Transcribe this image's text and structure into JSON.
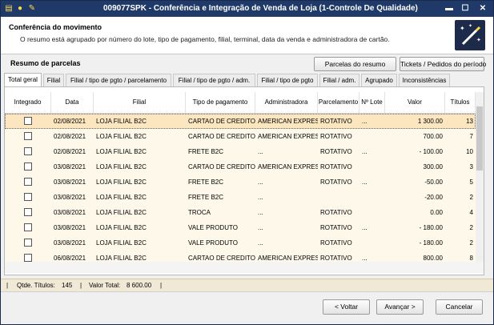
{
  "window": {
    "title": "009077SPK - Conferência e Integração de Venda de Loja (1-Controle De Qualidade)",
    "buttons": {
      "minimize": "▬",
      "maximize": "☐",
      "close": "✕"
    }
  },
  "header": {
    "title": "Conferência do movimento",
    "subtitle": "O resumo está agrupado por número do lote, tipo de pagamento, filial, terminal, data da venda e administradora de cartão."
  },
  "summary": {
    "title": "Resumo de parcelas",
    "btn_parcelas": "Parcelas do resumo",
    "btn_tickets": "Tickets / Pedidos do período"
  },
  "tabs": [
    {
      "label": "Total geral"
    },
    {
      "label": "Filial"
    },
    {
      "label": "Filial / tipo de pgto / parcelamento"
    },
    {
      "label": "Filial / tipo de pgto / adm."
    },
    {
      "label": "Filial / tipo de pgto"
    },
    {
      "label": "Filial / adm."
    },
    {
      "label": "Agrupado"
    },
    {
      "label": "Inconsistências"
    }
  ],
  "grid": {
    "columns": [
      "Integrado",
      "Data",
      "Filial",
      "Tipo de pagamento",
      "Administradora",
      "Parcelamento",
      "Nº Lote",
      "Valor",
      "Títulos"
    ],
    "rows": [
      {
        "data": "02/08/2021",
        "filial": "LOJA FILIAL B2C",
        "tipo": "CARTAO DE CREDITO F",
        "adm": "AMERICAN EXPRESS",
        "parc": "ROTATIVO",
        "lote": "...",
        "valor": "1 300.00",
        "titulos": "13"
      },
      {
        "data": "02/08/2021",
        "filial": "LOJA FILIAL B2C",
        "tipo": "CARTAO DE CREDITO F",
        "adm": "AMERICAN EXPRESS",
        "parc": "ROTATIVO",
        "lote": "",
        "valor": "700.00",
        "titulos": "7"
      },
      {
        "data": "02/08/2021",
        "filial": "LOJA FILIAL B2C",
        "tipo": "FRETE B2C",
        "adm": "...",
        "parc": "ROTATIVO",
        "lote": "...",
        "valor": "- 100.00",
        "titulos": "10"
      },
      {
        "data": "03/08/2021",
        "filial": "LOJA FILIAL B2C",
        "tipo": "CARTAO DE CREDITO F",
        "adm": "AMERICAN EXPRESS",
        "parc": "ROTATIVO",
        "lote": "",
        "valor": "300.00",
        "titulos": "3"
      },
      {
        "data": "03/08/2021",
        "filial": "LOJA FILIAL B2C",
        "tipo": "FRETE B2C",
        "adm": "...",
        "parc": "ROTATIVO",
        "lote": "...",
        "valor": "-50.00",
        "titulos": "5"
      },
      {
        "data": "03/08/2021",
        "filial": "LOJA FILIAL B2C",
        "tipo": "FRETE B2C",
        "adm": "...",
        "parc": "",
        "lote": "",
        "valor": "-20.00",
        "titulos": "2"
      },
      {
        "data": "03/08/2021",
        "filial": "LOJA FILIAL B2C",
        "tipo": "TROCA",
        "adm": "...",
        "parc": "ROTATIVO",
        "lote": "",
        "valor": "0.00",
        "titulos": "4"
      },
      {
        "data": "03/08/2021",
        "filial": "LOJA FILIAL B2C",
        "tipo": "VALE PRODUTO",
        "adm": "...",
        "parc": "ROTATIVO",
        "lote": "...",
        "valor": "- 180.00",
        "titulos": "2"
      },
      {
        "data": "03/08/2021",
        "filial": "LOJA FILIAL B2C",
        "tipo": "VALE PRODUTO",
        "adm": "...",
        "parc": "ROTATIVO",
        "lote": "",
        "valor": "- 180.00",
        "titulos": "2"
      },
      {
        "data": "06/08/2021",
        "filial": "LOJA FILIAL B2C",
        "tipo": "CARTAO DE CREDITO F",
        "adm": "AMERICAN EXPRESS",
        "parc": "ROTATIVO",
        "lote": "...",
        "valor": "800.00",
        "titulos": "8"
      }
    ]
  },
  "status": {
    "qtde_label": "Qtde. Títulos:",
    "qtde_value": "145",
    "total_label": "Valor Total:",
    "total_value": "8 600.00"
  },
  "footer": {
    "voltar": "< Voltar",
    "avancar": "Avançar >",
    "cancelar": "Cancelar"
  }
}
